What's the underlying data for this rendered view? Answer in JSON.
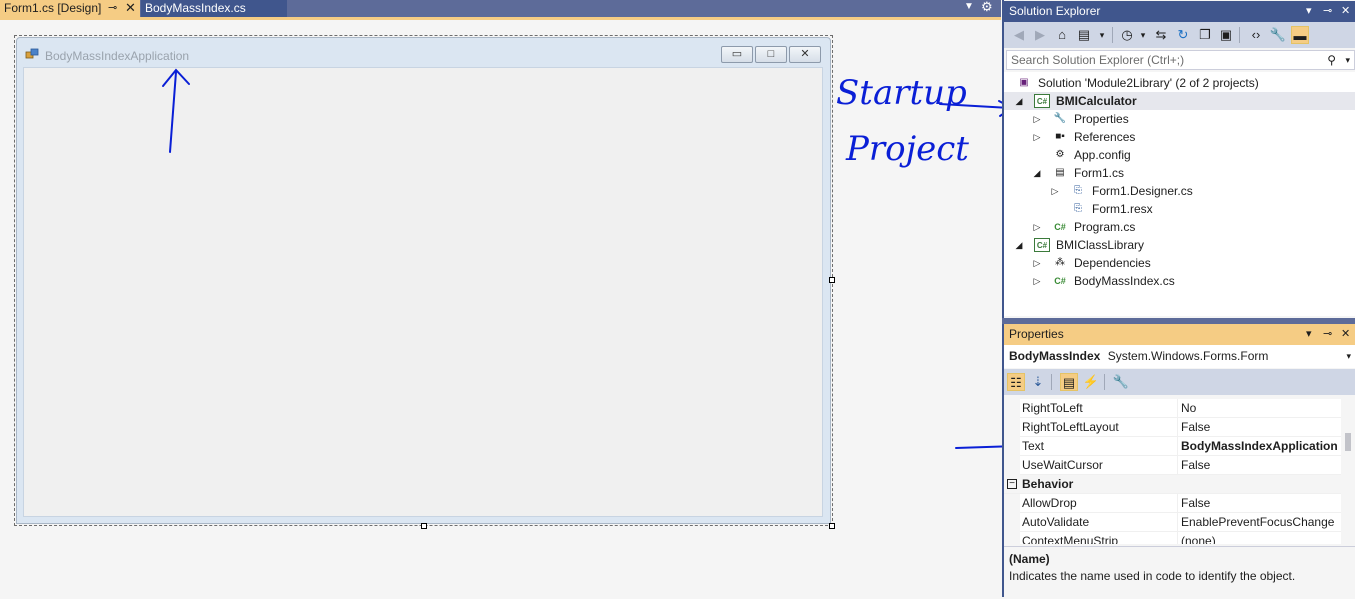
{
  "document_tabs": [
    {
      "label": "Form1.cs [Design]",
      "active": true
    },
    {
      "label": "BodyMassIndex.cs",
      "active": false
    }
  ],
  "tab_pin_icon": "pin-icon",
  "tab_close_icon": "close-icon",
  "form": {
    "title": "BodyMassIndexApplication",
    "minimize": "▭",
    "maximize": "□",
    "close": "✕"
  },
  "annotations": {
    "startup_line1": "Startup",
    "startup_line2": "Project"
  },
  "solution_explorer": {
    "title": "Solution Explorer",
    "search_placeholder": "Search Solution Explorer (Ctrl+;)",
    "tree": [
      {
        "label": "Solution 'Module2Library' (2 of 2 projects)",
        "depth": 0,
        "expander": "",
        "icon": "solution-icon"
      },
      {
        "label": "BMICalculator",
        "depth": 0,
        "expander": "◢",
        "icon": "csharp-project-icon",
        "bold": true,
        "selected": true
      },
      {
        "label": "Properties",
        "depth": 1,
        "expander": "▷",
        "icon": "wrench-icon"
      },
      {
        "label": "References",
        "depth": 1,
        "expander": "▷",
        "icon": "references-icon"
      },
      {
        "label": "App.config",
        "depth": 1,
        "expander": "",
        "icon": "config-file-icon"
      },
      {
        "label": "Form1.cs",
        "depth": 1,
        "expander": "◢",
        "icon": "form-icon"
      },
      {
        "label": "Form1.Designer.cs",
        "depth": 2,
        "expander": "▷",
        "icon": "designer-file-icon"
      },
      {
        "label": "Form1.resx",
        "depth": 2,
        "expander": "",
        "icon": "resx-file-icon"
      },
      {
        "label": "Program.cs",
        "depth": 1,
        "expander": "▷",
        "icon": "csharp-file-icon"
      },
      {
        "label": "BMIClassLibrary",
        "depth": 0,
        "expander": "◢",
        "icon": "csharp-project-icon"
      },
      {
        "label": "Dependencies",
        "depth": 1,
        "expander": "▷",
        "icon": "dependencies-icon"
      },
      {
        "label": "BodyMassIndex.cs",
        "depth": 1,
        "expander": "▷",
        "icon": "csharp-file-icon"
      }
    ]
  },
  "properties": {
    "title": "Properties",
    "object_name": "BodyMassIndex",
    "object_type": "System.Windows.Forms.Form",
    "rows": [
      {
        "name": "RightToLeft",
        "value": "No"
      },
      {
        "name": "RightToLeftLayout",
        "value": "False"
      },
      {
        "name": "Text",
        "value": "BodyMassIndexApplication",
        "bold_value": true
      },
      {
        "name": "UseWaitCursor",
        "value": "False"
      },
      {
        "name": "Behavior",
        "category": true
      },
      {
        "name": "AllowDrop",
        "value": "False"
      },
      {
        "name": "AutoValidate",
        "value": "EnablePreventFocusChange"
      },
      {
        "name": "ContextMenuStrip",
        "value": "(none)"
      }
    ],
    "description_title": "(Name)",
    "description_text": "Indicates the name used in code to identify the object."
  },
  "colors": {
    "tab_active": "#f5cc84",
    "tab_inactive": "#40568d",
    "annotation_ink": "#0a1fd6"
  }
}
